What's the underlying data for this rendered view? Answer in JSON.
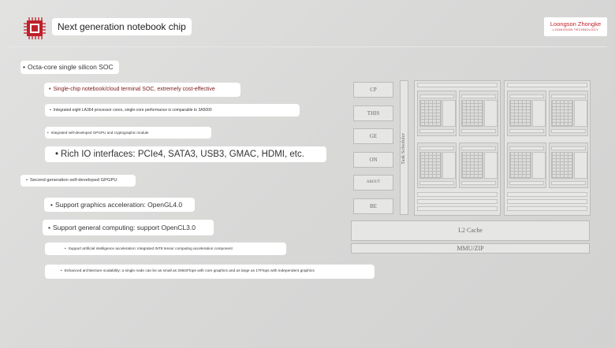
{
  "header": {
    "title": "Next generation notebook chip",
    "brand_name": "Loongson Zhongke",
    "brand_sub": "LOONGSON TECHNOLOGY",
    "logo_icon": "chip-icon",
    "accent_color": "#c0202a"
  },
  "bullets": {
    "b1": "Octa-core single silicon SOC",
    "b1a": "Single-chip notebook/cloud terminal SOC, extremely cost-effective",
    "b1b": "Integrated eight LA364 processor cores, single-core performance is comparable to 3A5000",
    "b1c": "Integrated self-developed GPGPU and cryptographic module",
    "b1d": "Rich IO interfaces: PCIe4, SATA3, USB3, GMAC, HDMI, etc.",
    "b2": "Second generation self-developed GPGPU",
    "b2a": "Support graphics acceleration: OpenGL4.0",
    "b2b": "Support general computing: support OpenCL3.0",
    "b2c": "Support artificial intelligence acceleration: integrated INT8 tensor computing acceleration component",
    "b2d": "Enhanced architecture scalability: a single node can be as small as 256GFlops with core graphics and as large as 1TFlops with independent graphics"
  },
  "diagram": {
    "side_buttons": [
      "CP",
      "THIS",
      "GE",
      "ON",
      "ABOUT",
      "BE"
    ],
    "scheduler": "Task Scheduler",
    "l2": "L2 Cache",
    "mmu": "MMU/ZIP"
  }
}
